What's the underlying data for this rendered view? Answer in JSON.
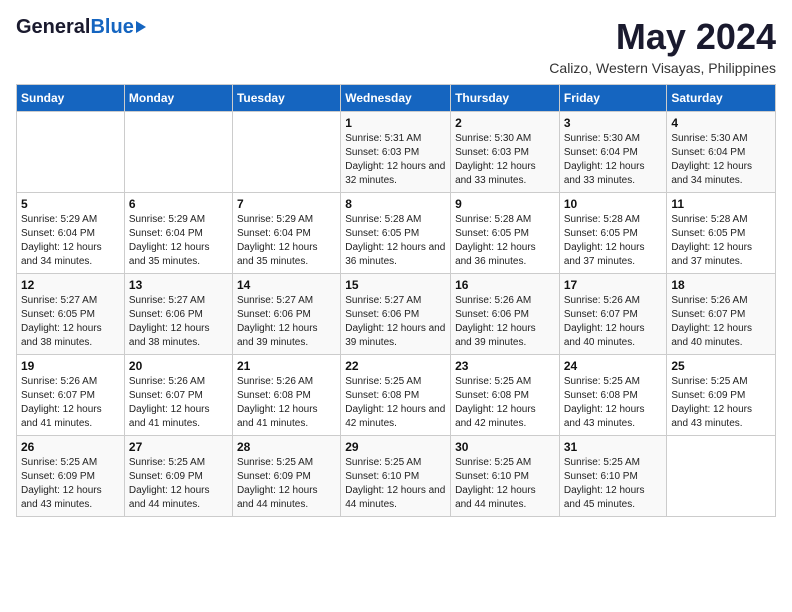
{
  "logo": {
    "general": "General",
    "blue": "Blue"
  },
  "title": "May 2024",
  "subtitle": "Calizo, Western Visayas, Philippines",
  "days_of_week": [
    "Sunday",
    "Monday",
    "Tuesday",
    "Wednesday",
    "Thursday",
    "Friday",
    "Saturday"
  ],
  "weeks": [
    [
      {
        "day": "",
        "sunrise": "",
        "sunset": "",
        "daylight": ""
      },
      {
        "day": "",
        "sunrise": "",
        "sunset": "",
        "daylight": ""
      },
      {
        "day": "",
        "sunrise": "",
        "sunset": "",
        "daylight": ""
      },
      {
        "day": "1",
        "sunrise": "Sunrise: 5:31 AM",
        "sunset": "Sunset: 6:03 PM",
        "daylight": "Daylight: 12 hours and 32 minutes."
      },
      {
        "day": "2",
        "sunrise": "Sunrise: 5:30 AM",
        "sunset": "Sunset: 6:03 PM",
        "daylight": "Daylight: 12 hours and 33 minutes."
      },
      {
        "day": "3",
        "sunrise": "Sunrise: 5:30 AM",
        "sunset": "Sunset: 6:04 PM",
        "daylight": "Daylight: 12 hours and 33 minutes."
      },
      {
        "day": "4",
        "sunrise": "Sunrise: 5:30 AM",
        "sunset": "Sunset: 6:04 PM",
        "daylight": "Daylight: 12 hours and 34 minutes."
      }
    ],
    [
      {
        "day": "5",
        "sunrise": "Sunrise: 5:29 AM",
        "sunset": "Sunset: 6:04 PM",
        "daylight": "Daylight: 12 hours and 34 minutes."
      },
      {
        "day": "6",
        "sunrise": "Sunrise: 5:29 AM",
        "sunset": "Sunset: 6:04 PM",
        "daylight": "Daylight: 12 hours and 35 minutes."
      },
      {
        "day": "7",
        "sunrise": "Sunrise: 5:29 AM",
        "sunset": "Sunset: 6:04 PM",
        "daylight": "Daylight: 12 hours and 35 minutes."
      },
      {
        "day": "8",
        "sunrise": "Sunrise: 5:28 AM",
        "sunset": "Sunset: 6:05 PM",
        "daylight": "Daylight: 12 hours and 36 minutes."
      },
      {
        "day": "9",
        "sunrise": "Sunrise: 5:28 AM",
        "sunset": "Sunset: 6:05 PM",
        "daylight": "Daylight: 12 hours and 36 minutes."
      },
      {
        "day": "10",
        "sunrise": "Sunrise: 5:28 AM",
        "sunset": "Sunset: 6:05 PM",
        "daylight": "Daylight: 12 hours and 37 minutes."
      },
      {
        "day": "11",
        "sunrise": "Sunrise: 5:28 AM",
        "sunset": "Sunset: 6:05 PM",
        "daylight": "Daylight: 12 hours and 37 minutes."
      }
    ],
    [
      {
        "day": "12",
        "sunrise": "Sunrise: 5:27 AM",
        "sunset": "Sunset: 6:05 PM",
        "daylight": "Daylight: 12 hours and 38 minutes."
      },
      {
        "day": "13",
        "sunrise": "Sunrise: 5:27 AM",
        "sunset": "Sunset: 6:06 PM",
        "daylight": "Daylight: 12 hours and 38 minutes."
      },
      {
        "day": "14",
        "sunrise": "Sunrise: 5:27 AM",
        "sunset": "Sunset: 6:06 PM",
        "daylight": "Daylight: 12 hours and 39 minutes."
      },
      {
        "day": "15",
        "sunrise": "Sunrise: 5:27 AM",
        "sunset": "Sunset: 6:06 PM",
        "daylight": "Daylight: 12 hours and 39 minutes."
      },
      {
        "day": "16",
        "sunrise": "Sunrise: 5:26 AM",
        "sunset": "Sunset: 6:06 PM",
        "daylight": "Daylight: 12 hours and 39 minutes."
      },
      {
        "day": "17",
        "sunrise": "Sunrise: 5:26 AM",
        "sunset": "Sunset: 6:07 PM",
        "daylight": "Daylight: 12 hours and 40 minutes."
      },
      {
        "day": "18",
        "sunrise": "Sunrise: 5:26 AM",
        "sunset": "Sunset: 6:07 PM",
        "daylight": "Daylight: 12 hours and 40 minutes."
      }
    ],
    [
      {
        "day": "19",
        "sunrise": "Sunrise: 5:26 AM",
        "sunset": "Sunset: 6:07 PM",
        "daylight": "Daylight: 12 hours and 41 minutes."
      },
      {
        "day": "20",
        "sunrise": "Sunrise: 5:26 AM",
        "sunset": "Sunset: 6:07 PM",
        "daylight": "Daylight: 12 hours and 41 minutes."
      },
      {
        "day": "21",
        "sunrise": "Sunrise: 5:26 AM",
        "sunset": "Sunset: 6:08 PM",
        "daylight": "Daylight: 12 hours and 41 minutes."
      },
      {
        "day": "22",
        "sunrise": "Sunrise: 5:25 AM",
        "sunset": "Sunset: 6:08 PM",
        "daylight": "Daylight: 12 hours and 42 minutes."
      },
      {
        "day": "23",
        "sunrise": "Sunrise: 5:25 AM",
        "sunset": "Sunset: 6:08 PM",
        "daylight": "Daylight: 12 hours and 42 minutes."
      },
      {
        "day": "24",
        "sunrise": "Sunrise: 5:25 AM",
        "sunset": "Sunset: 6:08 PM",
        "daylight": "Daylight: 12 hours and 43 minutes."
      },
      {
        "day": "25",
        "sunrise": "Sunrise: 5:25 AM",
        "sunset": "Sunset: 6:09 PM",
        "daylight": "Daylight: 12 hours and 43 minutes."
      }
    ],
    [
      {
        "day": "26",
        "sunrise": "Sunrise: 5:25 AM",
        "sunset": "Sunset: 6:09 PM",
        "daylight": "Daylight: 12 hours and 43 minutes."
      },
      {
        "day": "27",
        "sunrise": "Sunrise: 5:25 AM",
        "sunset": "Sunset: 6:09 PM",
        "daylight": "Daylight: 12 hours and 44 minutes."
      },
      {
        "day": "28",
        "sunrise": "Sunrise: 5:25 AM",
        "sunset": "Sunset: 6:09 PM",
        "daylight": "Daylight: 12 hours and 44 minutes."
      },
      {
        "day": "29",
        "sunrise": "Sunrise: 5:25 AM",
        "sunset": "Sunset: 6:10 PM",
        "daylight": "Daylight: 12 hours and 44 minutes."
      },
      {
        "day": "30",
        "sunrise": "Sunrise: 5:25 AM",
        "sunset": "Sunset: 6:10 PM",
        "daylight": "Daylight: 12 hours and 44 minutes."
      },
      {
        "day": "31",
        "sunrise": "Sunrise: 5:25 AM",
        "sunset": "Sunset: 6:10 PM",
        "daylight": "Daylight: 12 hours and 45 minutes."
      },
      {
        "day": "",
        "sunrise": "",
        "sunset": "",
        "daylight": ""
      }
    ]
  ]
}
